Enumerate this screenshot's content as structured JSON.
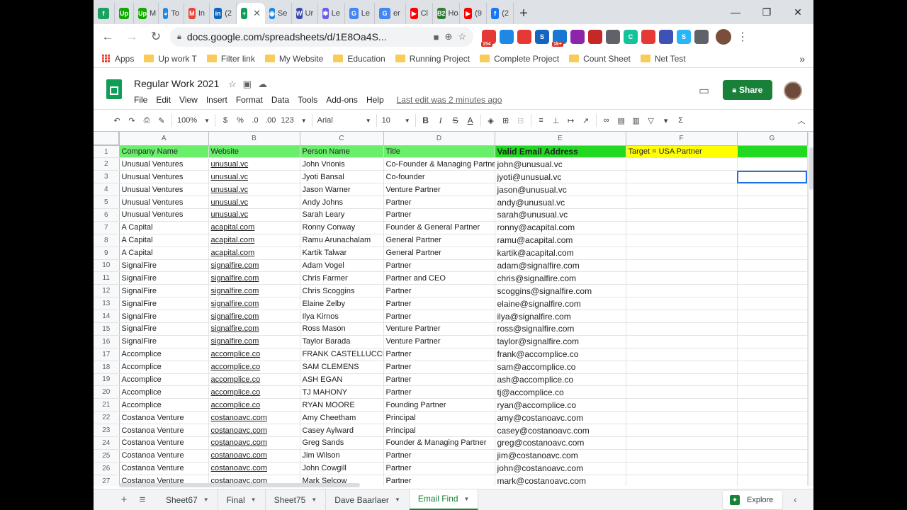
{
  "browser": {
    "tabs": [
      {
        "name": "tab-1",
        "label": "",
        "fav": "f",
        "color": "#1aa260"
      },
      {
        "name": "tab-2",
        "label": "",
        "fav": "Up",
        "color": "#14a800"
      },
      {
        "name": "tab-3",
        "label": "M",
        "fav": "Up",
        "color": "#14a800"
      },
      {
        "name": "tab-4",
        "label": "To",
        "fav": "◕",
        "color": "#1e88e5"
      },
      {
        "name": "tab-5",
        "label": "In",
        "fav": "M",
        "color": "#ea4335"
      },
      {
        "name": "tab-6",
        "label": "(2",
        "fav": "in",
        "color": "#0a66c2"
      },
      {
        "name": "tab-7",
        "label": "",
        "fav": "+",
        "color": "#0f9d58",
        "active": true
      },
      {
        "name": "tab-8",
        "label": "Se",
        "fav": "◉",
        "color": "#1e88e5"
      },
      {
        "name": "tab-9",
        "label": "Ur",
        "fav": "W",
        "color": "#3949ab"
      },
      {
        "name": "tab-10",
        "label": "Le",
        "fav": "✱",
        "color": "#6b5ce7"
      },
      {
        "name": "tab-11",
        "label": "Le",
        "fav": "G",
        "color": "#4285f4"
      },
      {
        "name": "tab-12",
        "label": "er",
        "fav": "G",
        "color": "#4285f4"
      },
      {
        "name": "tab-13",
        "label": "Cl",
        "fav": "▶",
        "color": "#ff0000"
      },
      {
        "name": "tab-14",
        "label": "Ho",
        "fav": "B2",
        "color": "#2e7d32"
      },
      {
        "name": "tab-15",
        "label": "(9",
        "fav": "▶",
        "color": "#ff0000"
      },
      {
        "name": "tab-16",
        "label": "(2",
        "fav": "f",
        "color": "#1877f2"
      }
    ],
    "url": "docs.google.com/spreadsheets/d/1E8Oa4S...",
    "extensions": [
      {
        "name": "ext-1",
        "label": "",
        "color": "#e53935",
        "badge": "154"
      },
      {
        "name": "ext-2",
        "label": "",
        "color": "#1e88e5"
      },
      {
        "name": "ext-3",
        "label": "",
        "color": "#e53935"
      },
      {
        "name": "ext-4",
        "label": "S",
        "color": "#1565c0"
      },
      {
        "name": "ext-5",
        "label": "",
        "color": "#1976d2",
        "badge": "1k+"
      },
      {
        "name": "ext-6",
        "label": "",
        "color": "#8e24aa"
      },
      {
        "name": "ext-7",
        "label": "",
        "color": "#c62828"
      },
      {
        "name": "ext-8",
        "label": "",
        "color": "#5f6368"
      },
      {
        "name": "ext-9",
        "label": "C",
        "color": "#15c39a"
      },
      {
        "name": "ext-10",
        "label": "",
        "color": "#e53935"
      },
      {
        "name": "ext-11",
        "label": "",
        "color": "#3f51b5"
      },
      {
        "name": "ext-12",
        "label": "S",
        "color": "#29b6f6"
      },
      {
        "name": "ext-13",
        "label": "",
        "color": "#5f6368"
      }
    ],
    "bookmarks": {
      "apps": "Apps",
      "items": [
        "Up work T",
        "Filter link",
        "My Website",
        "Education",
        "Running Project",
        "Complete Project",
        "Count Sheet",
        "Net Test"
      ]
    }
  },
  "sheets": {
    "title": "Regular Work 2021",
    "menu": [
      "File",
      "Edit",
      "View",
      "Insert",
      "Format",
      "Data",
      "Tools",
      "Add-ons",
      "Help"
    ],
    "last_edit": "Last edit was 2 minutes ago",
    "share_label": "Share",
    "toolbar": {
      "zoom": "100%",
      "currency": "$",
      "percent": "%",
      "dec_less": ".0",
      "dec_more": ".00",
      "num_format": "123",
      "font": "Arial",
      "font_size": "10",
      "bold": "B",
      "italic": "I",
      "strike": "S",
      "text_color": "A"
    },
    "columns": [
      "A",
      "B",
      "C",
      "D",
      "E",
      "F",
      "G"
    ],
    "header_row": {
      "company": "Company Name",
      "website": "Website",
      "person": "Person Name",
      "title": "Title",
      "email": "Valid Email Address",
      "target": "Target =  USA  Partner"
    },
    "rows": [
      [
        "Unusual Ventures",
        "unusual.vc",
        "John Vrionis",
        "Co-Founder & Managing Partner",
        "john@unusual.vc"
      ],
      [
        "Unusual Ventures",
        "unusual.vc",
        "Jyoti Bansal",
        "Co-founder",
        "jyoti@unusual.vc"
      ],
      [
        "Unusual Ventures",
        "unusual.vc",
        "Jason Warner",
        "Venture Partner",
        "jason@unusual.vc"
      ],
      [
        "Unusual Ventures",
        "unusual.vc",
        "Andy Johns",
        "Partner",
        "andy@unusual.vc"
      ],
      [
        "Unusual Ventures",
        "unusual.vc",
        "Sarah Leary",
        "Partner",
        "sarah@unusual.vc"
      ],
      [
        "A Capital",
        "acapital.com",
        "Ronny Conway",
        "Founder & General Partner",
        "ronny@acapital.com"
      ],
      [
        "A Capital",
        "acapital.com",
        "Ramu Arunachalam",
        "General Partner",
        "ramu@acapital.com"
      ],
      [
        "A Capital",
        "acapital.com",
        "Kartik Talwar",
        "General Partner",
        "kartik@acapital.com"
      ],
      [
        "SignalFire",
        "signalfire.com",
        "Adam Vogel",
        "Partner",
        "adam@signalfire.com"
      ],
      [
        "SignalFire",
        "signalfire.com",
        "Chris Farmer",
        "Partner and CEO",
        "chris@signalfire.com"
      ],
      [
        "SignalFire",
        "signalfire.com",
        "Chris Scoggins",
        "Partner",
        "scoggins@signalfire.com"
      ],
      [
        "SignalFire",
        "signalfire.com",
        "Elaine Zelby",
        "Partner",
        "elaine@signalfire.com"
      ],
      [
        "SignalFire",
        "signalfire.com",
        "Ilya Kirnos",
        "Partner",
        "ilya@signalfire.com"
      ],
      [
        "SignalFire",
        "signalfire.com",
        "Ross Mason",
        "Venture Partner",
        "ross@signalfire.com"
      ],
      [
        "SignalFire",
        "signalfire.com",
        "Taylor Barada",
        "Venture Partner",
        "taylor@signalfire.com"
      ],
      [
        "Accomplice",
        "accomplice.co",
        "FRANK CASTELLUCCI",
        "Partner",
        "frank@accomplice.co"
      ],
      [
        "Accomplice",
        "accomplice.co",
        "SAM CLEMENS",
        "Partner",
        "sam@accomplice.co"
      ],
      [
        "Accomplice",
        "accomplice.co",
        "ASH EGAN",
        "Partner",
        "ash@accomplice.co"
      ],
      [
        "Accomplice",
        "accomplice.co",
        "TJ MAHONY",
        "Partner",
        "tj@accomplice.co"
      ],
      [
        "Accomplice",
        "accomplice.co",
        "RYAN MOORE",
        "Founding Partner",
        "ryan@accomplice.co"
      ],
      [
        "Costanoa Venture",
        "costanoavc.com",
        "Amy Cheetham",
        "Principal",
        "amy@costanoavc.com"
      ],
      [
        "Costanoa Venture",
        "costanoavc.com",
        "Casey Aylward",
        "Principal",
        "casey@costanoavc.com"
      ],
      [
        "Costanoa Venture",
        "costanoavc.com",
        "Greg Sands",
        "Founder & Managing Partner",
        "greg@costanoavc.com"
      ],
      [
        "Costanoa Venture",
        "costanoavc.com",
        "Jim Wilson",
        "Partner",
        "jim@costanoavc.com"
      ],
      [
        "Costanoa Venture",
        "costanoavc.com",
        "John Cowgill",
        "Partner",
        "john@costanoavc.com"
      ],
      [
        "Costanoa Venture",
        "costanoavc.com",
        "Mark Selcow",
        "Partner",
        "mark@costanoavc.com"
      ]
    ],
    "sheet_tabs": [
      "Sheet67",
      "Final",
      "Sheet75",
      "Dave Baarlaer",
      "Email Find"
    ],
    "active_sheet": "Email Find",
    "explore_label": "Explore",
    "colors": {
      "header_green": "#6aef6a",
      "email_header_green": "#22d922",
      "target_yellow": "#ffff00",
      "accent": "#188038"
    }
  }
}
